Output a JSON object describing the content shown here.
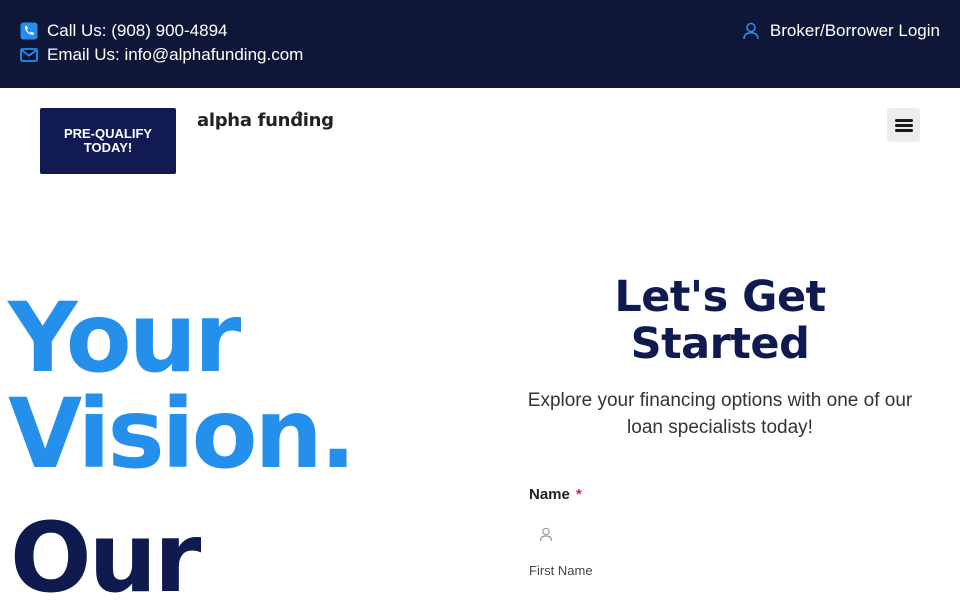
{
  "topbar": {
    "phone_text": "Call Us: (908) 900-4894",
    "email_text": "Email Us: info@alphafunding.com",
    "login_text": "Broker/Borrower Login",
    "icons": {
      "phone": "phone-icon",
      "email": "envelope-icon",
      "login": "user-icon"
    }
  },
  "header": {
    "cta_label": "PRE-QUALIFY TODAY!",
    "logo_text": "alpha funding",
    "menu_icon": "hamburger-menu-icon"
  },
  "hero": {
    "line1": "Your",
    "line2": "Vision.",
    "line3": "Our"
  },
  "form": {
    "title": "Let's Get Started",
    "subtitle": "Explore your financing options with one of our loan specialists today!",
    "name_label": "Name",
    "required_mark": "*",
    "first_name_value": "",
    "first_name_sublabel": "First Name"
  },
  "colors": {
    "topbar_bg": "#0e1738",
    "accent_blue": "#2590ec",
    "navy": "#0f1a4f",
    "cta_bg": "#111b52",
    "required": "#e0213a"
  }
}
